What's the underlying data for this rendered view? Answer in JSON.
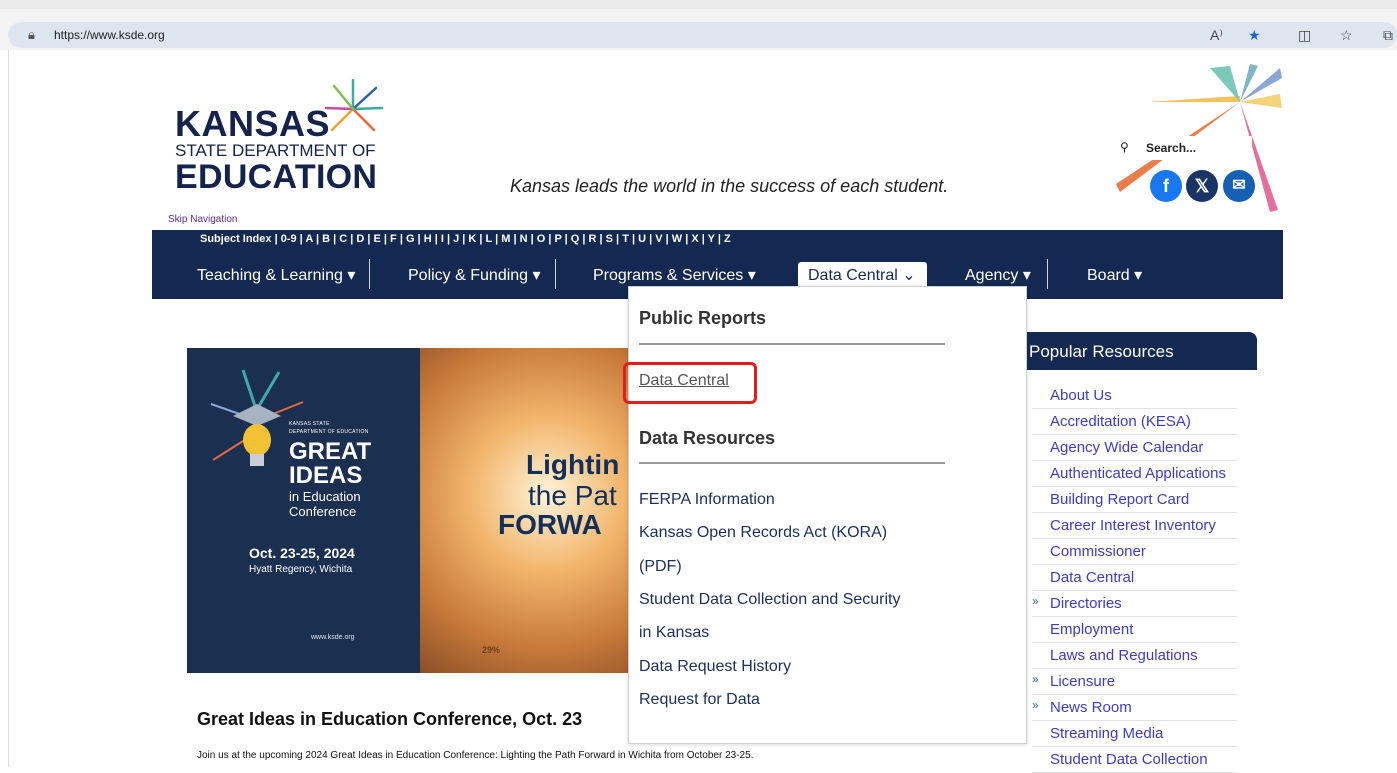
{
  "browser": {
    "url": "https://www.ksde.org"
  },
  "logo": {
    "line1": "KANSAS",
    "line2": "STATE DEPARTMENT OF",
    "line3": "EDUCATION"
  },
  "tagline": "Kansas leads the world in the success of each student.",
  "skip_navigation": "Skip Navigation",
  "search": {
    "placeholder": "Search..."
  },
  "subject_index": "Subject Index | 0-9 | A | B | C | D | E | F | G | H | I | J | K | L | M | N | O | P | Q | R | S | T | U | V | W | X | Y | Z",
  "menu": {
    "teaching": "Teaching & Learning ▾",
    "policy": "Policy & Funding ▾",
    "programs": "Programs & Services ▾",
    "data_central": "Data Central ⌄",
    "agency": "Agency ▾",
    "board": "Board ▾"
  },
  "hero": {
    "small_text_1": "KANSAS STATE",
    "small_text_2": "DEPARTMENT OF EDUCATION",
    "great": "GREAT",
    "ideas": "IDEAS",
    "in_education": "in Education",
    "conference": "Conference",
    "date": "Oct. 23-25, 2024",
    "venue": "Hyatt Regency, Wichita",
    "www": "www.ksde.org",
    "lighting": "Lightin",
    "the_path": "the Pat",
    "forward": "FORWA",
    "pct": "29%"
  },
  "dropdown": {
    "public_reports": "Public Reports",
    "data_central_link": "Data Central",
    "data_resources": "Data Resources",
    "links": [
      "FERPA Information",
      "Kansas Open Records Act (KORA)",
      "(PDF)",
      "Student Data Collection and Security",
      "in Kansas",
      "Data Request History",
      "Request for Data"
    ]
  },
  "popular": {
    "title": "Popular Resources",
    "items": [
      {
        "label": "About Us",
        "chev": ""
      },
      {
        "label": "Accreditation (KESA)",
        "chev": ""
      },
      {
        "label": "Agency Wide Calendar",
        "chev": ""
      },
      {
        "label": "Authenticated Applications",
        "chev": ""
      },
      {
        "label": "Building Report Card",
        "chev": ""
      },
      {
        "label": "Career Interest Inventory",
        "chev": ""
      },
      {
        "label": "Commissioner",
        "chev": ""
      },
      {
        "label": "Data Central",
        "chev": ""
      },
      {
        "label": "Directories",
        "chev": "»"
      },
      {
        "label": "Employment",
        "chev": ""
      },
      {
        "label": "Laws and Regulations",
        "chev": ""
      },
      {
        "label": "Licensure",
        "chev": "»"
      },
      {
        "label": "News Room",
        "chev": "»"
      },
      {
        "label": "Streaming Media",
        "chev": ""
      },
      {
        "label": "Student Data Collection",
        "chev": ""
      }
    ]
  },
  "headline": "Great Ideas in Education Conference, Oct. 23",
  "intro": "Join us at the upcoming 2024 Great Ideas in Education Conference: Lighting the Path Forward in Wichita from October 23-25."
}
